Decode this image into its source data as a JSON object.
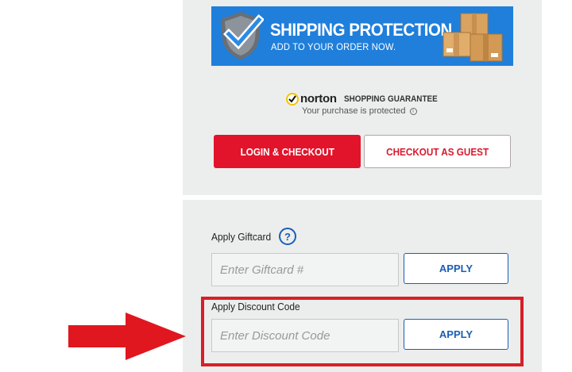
{
  "banner": {
    "title": "SHIPPING PROTECTION.",
    "subtitle": "ADD TO YOUR ORDER NOW.",
    "bg_color": "#1f7fdb"
  },
  "norton": {
    "brand": "norton",
    "guarantee": "SHOPPING GUARANTEE",
    "note": "Your purchase is protected",
    "info_icon": "i"
  },
  "checkout": {
    "login_label": "LOGIN & CHECKOUT",
    "guest_label": "CHECKOUT AS GUEST",
    "accent_color": "#e2142b"
  },
  "giftcard": {
    "label": "Apply Giftcard",
    "help_icon": "?",
    "placeholder": "Enter Giftcard #",
    "apply_label": "APPLY"
  },
  "discount": {
    "label": "Apply Discount Code",
    "placeholder": "Enter Discount Code",
    "apply_label": "APPLY"
  },
  "annotation": {
    "color": "#d81f27"
  }
}
